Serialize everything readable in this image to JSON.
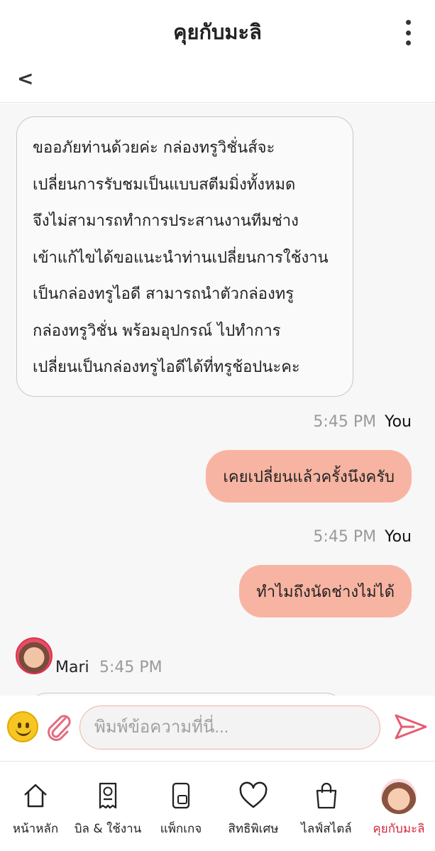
{
  "header": {
    "title": "คุยกับมะลิ",
    "back_label": "<"
  },
  "messages": [
    {
      "from": "agent",
      "lines": [
        "ขออภัยท่านด้วยค่ะ กล่องทรูวิชั่นส์จะ",
        "เปลี่ยนการรับชมเป็นแบบสตีมมิ่งทั้งหมด",
        "จึงไม่สามารถทำการประสานงานทีมช่าง",
        "เข้าแก้ไขได้ขอแนะนำท่านเปลี่ยนการใช้งาน",
        "เป็นกล่องทรูไอดี สามารถนำตัวกล่องทรู",
        "กล่องทรูวิชั่น พร้อมอุปกรณ์ ไปทำการ",
        "เปลี่ยนเป็นกล่องทรูไอดีได้ที่ทรูช้อปนะคะ"
      ]
    },
    {
      "from": "user",
      "time": "5:45 PM",
      "sender": "You",
      "text": "เคยเปลี่ยนแล้วครั้งนึงครับ"
    },
    {
      "from": "user",
      "time": "5:45 PM",
      "sender": "You",
      "text": "ทำไมถึงนัดช่างไม่ได้"
    },
    {
      "from": "agent",
      "time": "5:45 PM",
      "sender": "Mari"
    }
  ],
  "composer": {
    "placeholder": "พิมพ์ข้อความที่นี่..."
  },
  "tabs": [
    {
      "label": "หน้าหลัก",
      "icon": "home-icon"
    },
    {
      "label": "บิล & ใช้งาน",
      "icon": "bill-icon"
    },
    {
      "label": "แพ็กเกจ",
      "icon": "phone-sim-icon"
    },
    {
      "label": "สิทธิพิเศษ",
      "icon": "heart-icon"
    },
    {
      "label": "ไลฟ์สไตล์",
      "icon": "shopping-bag-icon"
    },
    {
      "label": "คุยกับมะลิ",
      "icon": "mali-avatar",
      "active": true
    }
  ],
  "colors": {
    "accent": "#d6263c",
    "user_bubble": "#f8b4a2",
    "chat_bg": "#f7f7f7"
  }
}
